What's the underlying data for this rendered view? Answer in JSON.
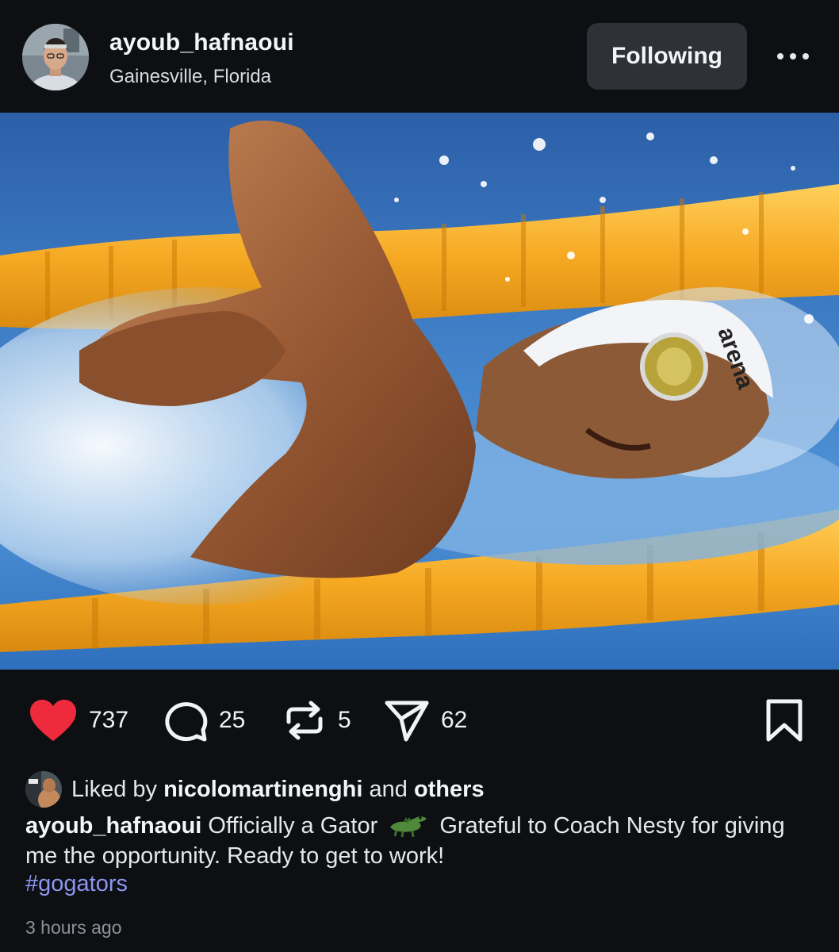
{
  "post": {
    "author": {
      "username": "ayoub_hafnaoui",
      "location": "Gainesville, Florida",
      "avatar_icon": "profile-photo"
    },
    "follow_button_label": "Following",
    "more_icon": "more-horizontal-icon",
    "photo": {
      "description_icon": "swimmer-photo"
    },
    "actions": {
      "likes": "737",
      "comments": "25",
      "reposts": "5",
      "shares": "62",
      "like_color": "#ed2b3c"
    },
    "liked_by": {
      "prefix": "Liked by",
      "user": "nicolomartinenghi",
      "joiner": "and",
      "suffix": "others"
    },
    "caption": {
      "username": "ayoub_hafnaoui",
      "text_before_emoji": "Officially a Gator",
      "emoji_icon": "crocodile-emoji",
      "text_after_emoji": "Grateful to Coach Nesty for giving me the opportunity. Ready to get to work!"
    },
    "hashtag": "#gogators",
    "timestamp": "3 hours ago"
  }
}
